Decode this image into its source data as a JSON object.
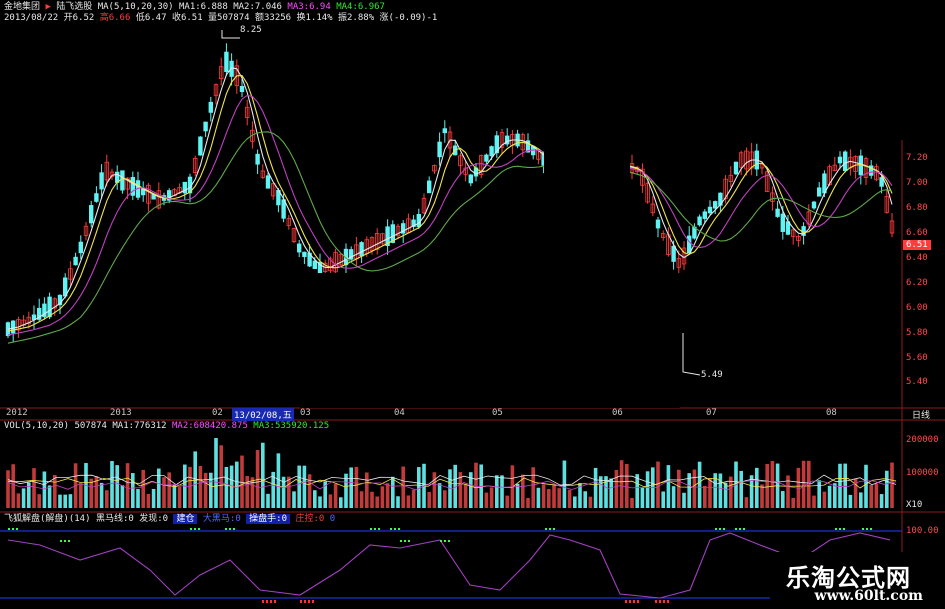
{
  "header": {
    "stock_name": "金地集团",
    "arrow": "▶",
    "formula_name": "陆飞选股",
    "ma_params": "MA(5,10,20,30)",
    "ma1": "MA1:6.888",
    "ma2": "MA2:7.046",
    "ma3": "MA3:6.94",
    "ma4": "MA4:6.967",
    "date": "2013/08/22",
    "open": "开6.52",
    "high": "高6.66",
    "low": "低6.47",
    "close": "收6.51",
    "volume": "量507874",
    "amount": "额33256",
    "turnover": "换1.14%",
    "amplitude": "振2.88%",
    "change": "涨(-0.09)-1"
  },
  "price_annotations": {
    "high_mark": "8.25",
    "low_mark": "5.49",
    "last_price": "6.51"
  },
  "price_axis": [
    "7.20",
    "7.00",
    "6.80",
    "6.60",
    "6.40",
    "6.20",
    "6.00",
    "5.80",
    "5.60",
    "5.40"
  ],
  "date_axis": [
    "2012",
    "2013",
    "02",
    "03",
    "04",
    "05",
    "06",
    "07",
    "08"
  ],
  "selected_date": "13/02/08,五",
  "period_label": "日线",
  "volume_panel": {
    "params": "VOL(5,10,20)",
    "vol": "507874",
    "ma1": "MA1:776312",
    "ma2": "MA2:608420.875",
    "ma3": "MA3:535920.125",
    "axis": [
      "200000",
      "100000",
      "X10"
    ]
  },
  "indicator_panel": {
    "name": "飞狐解盘(解盘)(14)",
    "black_horse": "黑马线:0",
    "discover": "发现:0",
    "tag1": "建仓",
    "tag2": "大黑马:0",
    "tag3": "操盘手:0",
    "tag4": "庄控:0",
    "tag5": "0",
    "axis": [
      "100.00",
      "0"
    ]
  },
  "watermark": {
    "line1": "乐淘公式网",
    "line2": "www.60lt.com"
  },
  "colors": {
    "up": "#ff3b3b",
    "down": "#5ff3f3",
    "ma_white": "#e8e8e8",
    "ma_yellow": "#f2e64b",
    "ma_magenta": "#c040c0",
    "ma_green": "#5fa84a",
    "indicator_line": "#a040c0"
  }
}
